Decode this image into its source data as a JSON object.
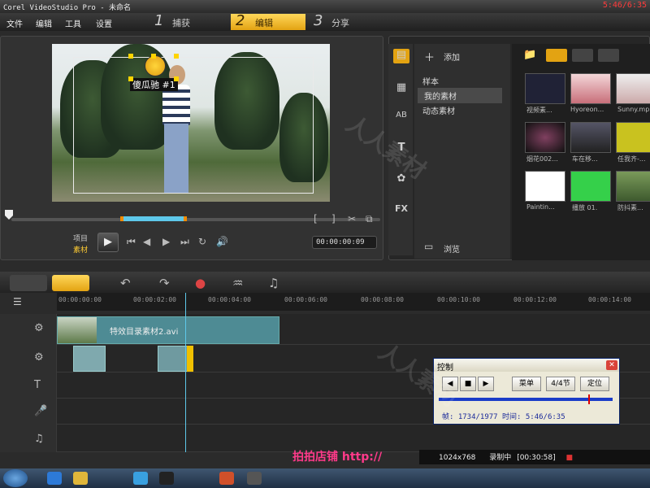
{
  "titlebar": {
    "app": "Corel VideoStudio Pro - 未命名",
    "clock": "5:46/6:35"
  },
  "menu": {
    "file": "文件",
    "edit": "编辑",
    "tools": "工具",
    "settings": "设置"
  },
  "steps": [
    {
      "num": "1",
      "label": "捕获"
    },
    {
      "num": "2",
      "label": "编辑"
    },
    {
      "num": "3",
      "label": "分享"
    }
  ],
  "preview": {
    "overlay_label": "傻瓜驰 #1",
    "project_label": "项目",
    "clip_label": "素材",
    "timecode": "00:00:00:09"
  },
  "library": {
    "add_label": "添加",
    "browse_label": "浏览",
    "nav": [
      "样本",
      "我的素材",
      "动态素材"
    ],
    "thumbs": [
      "视频素...",
      "Hyoreon...",
      "Sunny.mp",
      "烟花002...",
      "车在移...",
      "任我齐-...",
      "Paintin...",
      "播放 01.",
      "防抖素..."
    ]
  },
  "timeline": {
    "ticks": [
      "00:00:00:00",
      "00:00:02:00",
      "00:00:04:00",
      "00:00:06:00",
      "00:00:08:00",
      "00:00:10:00",
      "00:00:12:00",
      "00:00:14:00"
    ],
    "clip_name": "特效目录素材2.avi"
  },
  "control_window": {
    "title": "控制",
    "menu_btn": "菜单",
    "section_btn": "4/4节",
    "locate_btn": "定位",
    "info": "帧: 1734/1977 时间: 5:46/6:35"
  },
  "recorder": {
    "resolution": "1024x768",
    "status": "录制中",
    "time": "[00:30:58]"
  },
  "promo_text": "拍拍店铺 http://"
}
